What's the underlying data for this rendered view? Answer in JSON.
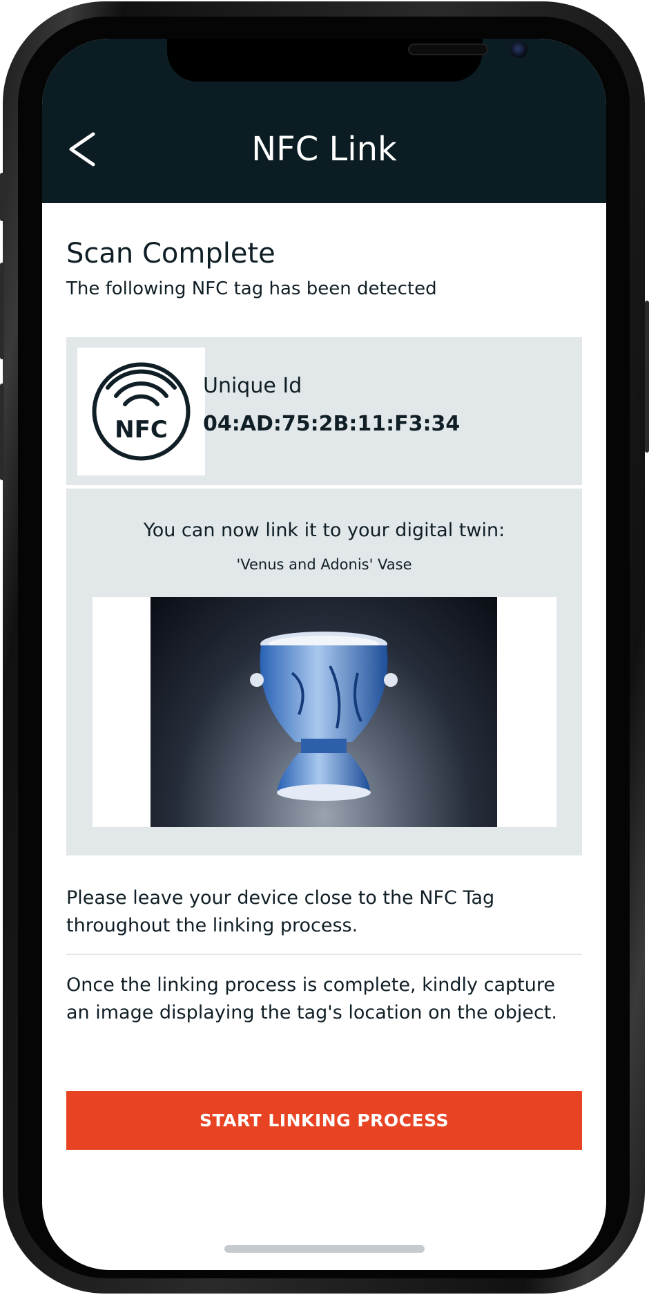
{
  "header": {
    "title": "NFC Link"
  },
  "scan": {
    "heading": "Scan Complete",
    "subtitle": "The following NFC tag has been detected"
  },
  "tag": {
    "logo_text": "NFC",
    "uid_label": "Unique Id",
    "uid_value": "04:AD:75:2B:11:F3:34"
  },
  "twin": {
    "prompt": "You can now link it to your digital twin:",
    "name": "'Venus and Adonis' Vase"
  },
  "instructions": {
    "line1": "Please leave your device close to the NFC Tag throughout the linking process.",
    "line2": "Once the linking process is complete, kindly capture an image displaying the tag's location on the object."
  },
  "actions": {
    "start_label": "START LINKING PROCESS"
  },
  "colors": {
    "header_bg": "#0b1c23",
    "accent": "#e84424",
    "card_bg": "#e2e7ea"
  },
  "icons": {
    "back": "chevron-left-icon",
    "nfc": "nfc-logo-icon"
  }
}
